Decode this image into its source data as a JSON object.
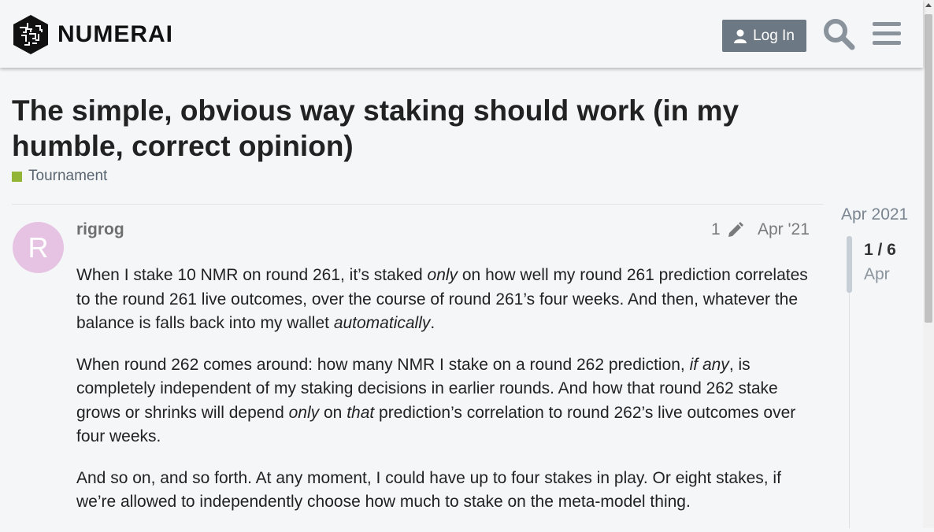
{
  "header": {
    "logo_text": "NUMERAI",
    "login_label": "Log In"
  },
  "topic": {
    "title": "The simple, obvious way staking should work (in my humble, correct opinion)",
    "category": "Tournament",
    "category_color": "#92b537"
  },
  "post": {
    "avatar_letter": "R",
    "avatar_color": "#e6c3e2",
    "username": "rigrog",
    "edit_count": "1",
    "date": "Apr '21",
    "paragraphs": [
      [
        {
          "text": "When I stake 10 NMR on round 261, it’s staked "
        },
        {
          "text": "only",
          "em": true
        },
        {
          "text": " on how well my round 261 prediction correlates to the round 261 live outcomes, over the course of round 261’s four weeks. And then, whatever the balance is falls back into my wallet "
        },
        {
          "text": "automatically",
          "em": true
        },
        {
          "text": "."
        }
      ],
      [
        {
          "text": "When round 262 comes around: how many NMR I stake on a round 262 prediction, "
        },
        {
          "text": "if any",
          "em": true
        },
        {
          "text": ", is completely independent of my staking decisions in earlier rounds. And how that round 262 stake grows or shrinks will depend "
        },
        {
          "text": "only",
          "em": true
        },
        {
          "text": " on "
        },
        {
          "text": "that",
          "em": true
        },
        {
          "text": " prediction’s correlation to round 262’s live outcomes over four weeks."
        }
      ],
      [
        {
          "text": "And so on, and so forth. At any moment, I could have up to four stakes in play. Or eight stakes, if we’re allowed to independently choose how much to stake on the meta-model thing."
        }
      ]
    ]
  },
  "timeline": {
    "top_date": "Apr 2021",
    "position": "1 / 6",
    "current_date": "Apr"
  }
}
